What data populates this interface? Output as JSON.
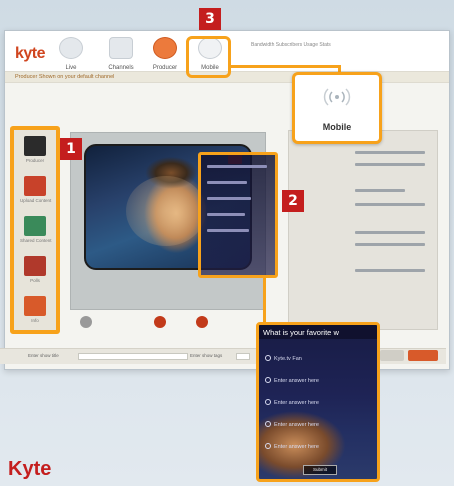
{
  "app": {
    "logo": "kyte",
    "nav": [
      {
        "label": "Live"
      },
      {
        "label": "Channels"
      },
      {
        "label": "Producer"
      },
      {
        "label": "Mobile"
      }
    ],
    "header_info": "Bandwidth Subscribers Usage Stats",
    "subbar_text": "Producer Shown on your default channel"
  },
  "sidebar": {
    "items": [
      {
        "label": "Producer",
        "color": "#2b2b2b"
      },
      {
        "label": "Upload Content",
        "color": "#c8422a"
      },
      {
        "label": "Shared Content",
        "color": "#3a8a5a"
      },
      {
        "label": "Polls",
        "color": "#b0392b"
      },
      {
        "label": "Info",
        "color": "#d85a2a"
      }
    ]
  },
  "callouts": {
    "one": "1",
    "two": "2",
    "three": "3"
  },
  "mobile_zoom": {
    "label": "Mobile"
  },
  "quiz": {
    "question": "What is your favorite w",
    "options": [
      "Kyte.tv Fan",
      "Enter answer here",
      "Enter answer here",
      "Enter answer here",
      "Enter answer here"
    ],
    "submit": "Submit"
  },
  "bottom": {
    "left_label": "Enter show title",
    "right_label": "Enter show tags"
  },
  "caption": "Kyte",
  "colors": {
    "highlight": "#f7a21b",
    "badge_red": "#c41e1e",
    "brand_orange": "#d0451f"
  }
}
